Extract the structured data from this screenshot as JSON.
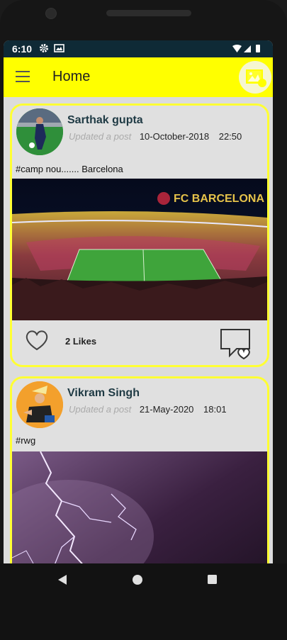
{
  "status_bar": {
    "time": "6:10",
    "icons": [
      "gear-icon",
      "image-icon",
      "wifi-icon",
      "signal-icon",
      "battery-icon"
    ]
  },
  "app_bar": {
    "title": "Home",
    "menu_icon": "hamburger-menu-icon",
    "action_icon": "add-image-icon",
    "color": "#ffff00"
  },
  "posts": [
    {
      "user": "Sarthak gupta",
      "updated_label": "Updated a post",
      "date": "10-October-2018",
      "time": "22:50",
      "caption": "#camp nou.......  Barcelona",
      "image_overlay_text": "FC BARCELONA",
      "likes": "2 Likes"
    },
    {
      "user": "Vikram Singh",
      "updated_label": "Updated a post",
      "date": "21-May-2020",
      "time": "18:01",
      "caption": "#rwg"
    }
  ],
  "nav": {
    "icons": [
      "back-icon",
      "home-icon",
      "recents-icon"
    ]
  }
}
